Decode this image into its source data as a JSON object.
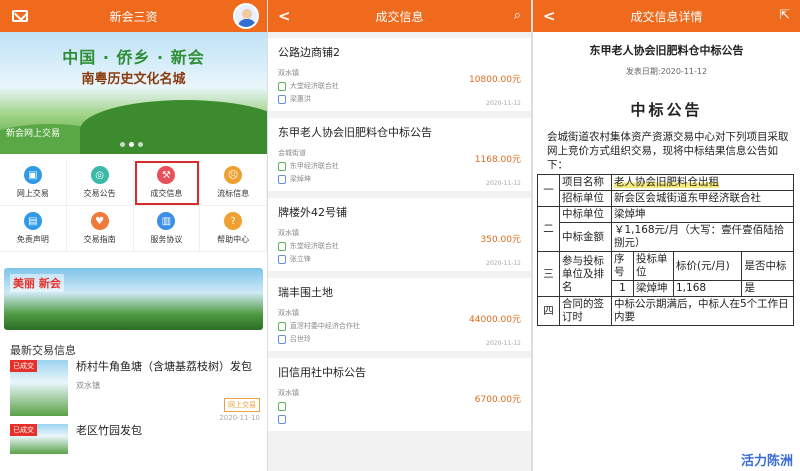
{
  "p1": {
    "title": "新会三资",
    "banner_title": "中国 · 侨乡 · 新会",
    "banner_sub": "南粤历史文化名城",
    "banner_caption": "新会网上交易",
    "grid": [
      {
        "label": "网上交易",
        "color": "#2f9be8"
      },
      {
        "label": "交易公告",
        "color": "#3cb9a8"
      },
      {
        "label": "成交信息",
        "color": "#e8505b"
      },
      {
        "label": "流标信息",
        "color": "#f0a030"
      },
      {
        "label": "免责声明",
        "color": "#2f9be8"
      },
      {
        "label": "交易指南",
        "color": "#f07a3a"
      },
      {
        "label": "服务协议",
        "color": "#3c8ee8"
      },
      {
        "label": "帮助中心",
        "color": "#f0a030"
      }
    ],
    "scenic_tag": "美丽 新会",
    "section_title": "最新交易信息",
    "news": [
      {
        "badge": "已成交",
        "title": "桥村牛角鱼塘（含塘基荔枝树）发包",
        "meta": "双水镇",
        "tag": "网上交易",
        "date": "2020-11-10"
      },
      {
        "badge": "已成交",
        "title": "老区竹园发包",
        "meta": "",
        "tag": "",
        "date": ""
      }
    ]
  },
  "p2": {
    "title": "成交信息",
    "cards": [
      {
        "title": "公路边商铺2",
        "line1": "双水镇",
        "price": "10800.00元",
        "line2": "大堂经济联合社",
        "line3": "梁惠洪",
        "date": "2020-11-12"
      },
      {
        "title": "东甲老人协会旧肥料仓中标公告",
        "line1": "会城街道",
        "price": "1168.00元",
        "line2": "东甲经济联合社",
        "line3": "梁焯坤",
        "date": "2020-11-12"
      },
      {
        "title": "牌楼外42号铺",
        "line1": "双水镇",
        "price": "350.00元",
        "line2": "东堂经济联合社",
        "line3": "张立锋",
        "date": "2020-11-12"
      },
      {
        "title": "瑞丰围土地",
        "line1": "双水镇",
        "price": "44000.00元",
        "line2": "直滘村委中经济合作社",
        "line3": "吕世玲",
        "date": "2020-11-12"
      },
      {
        "title": "旧信用社中标公告",
        "line1": "双水镇",
        "price": "6700.00元",
        "line2": "",
        "line3": "",
        "date": ""
      }
    ]
  },
  "p3": {
    "title": "成交信息详情",
    "doc_title": "东甲老人协会旧肥料仓中标公告",
    "doc_date": "发表日期:2020-11-12",
    "heading": "中标公告",
    "para": "会城街道农村集体资产资源交易中心对下列项目采取网上竞价方式组织交易，现将中标结果信息公告如下：",
    "t": {
      "c1": "一",
      "r1a": "项目名称",
      "r1b": "老人协会旧肥料仓出租",
      "r2a": "招标单位",
      "r2b": "新会区会城街道东甲经济联合社",
      "c2": "二",
      "r3a": "中标单位",
      "r3b": "梁焯坤",
      "r4a": "中标金额",
      "r4b": "￥1,168元/月（大写：壹仟壹佰陆拾捌元）",
      "c3": "三",
      "r5a": "参与投标单位及排名",
      "h1": "序号",
      "h2": "投标单位",
      "h3": "标价(元/月)",
      "h4": "是否中标",
      "n1": "1",
      "n2": "梁焯坤",
      "n3": "1,168",
      "n4": "是",
      "c4": "四",
      "r6a": "合同的签订时",
      "r6b": "中标公示期满后，中标人在5个工作日内要"
    },
    "watermark": "活力陈洲"
  }
}
